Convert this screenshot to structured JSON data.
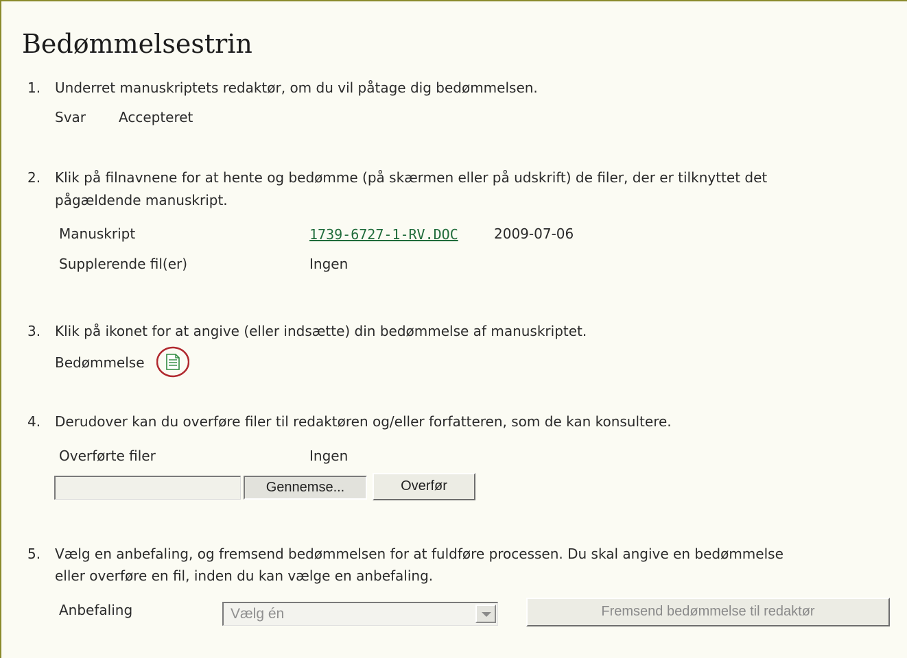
{
  "page": {
    "title": "Bedømmelsestrin"
  },
  "step1": {
    "number": "1.",
    "text": "Underret manuskriptets redaktør, om du vil påtage dig bedømmelsen.",
    "response_label": "Svar",
    "response_value": "Accepteret"
  },
  "step2": {
    "number": "2.",
    "text_line1": "Klik på filnavnene for at hente og bedømme (på skærmen eller på udskrift) de filer, der er tilknyttet det",
    "text_line2": "pågældende manuskript.",
    "manuscript_label": "Manuskript",
    "manuscript_file": "1739-6727-1-RV.DOC",
    "manuscript_date": "2009-07-06",
    "supplementary_label": "Supplerende fil(er)",
    "supplementary_value": "Ingen"
  },
  "step3": {
    "number": "3.",
    "text": "Klik på ikonet for at angive (eller indsætte) din bedømmelse af manuskriptet.",
    "review_label": "Bedømmelse",
    "review_icon": "document-icon",
    "highlight_color": "#b0282e"
  },
  "step4": {
    "number": "4.",
    "text": "Derudover kan du overføre filer til redaktøren og/eller forfatteren, som de kan konsultere.",
    "uploaded_label": "Overførte filer",
    "uploaded_value": "Ingen",
    "file_input_value": "",
    "browse_label": "Gennemse...",
    "upload_label": "Overfør"
  },
  "step5": {
    "number": "5.",
    "text_line1": "Vælg en anbefaling, og fremsend bedømmelsen for at fuldføre processen. Du skal angive en bedømmelse",
    "text_line2": "eller overføre en fil, inden du kan vælge en anbefaling.",
    "recommendation_label": "Anbefaling",
    "recommendation_selected": "Vælg én",
    "submit_label": "Fremsend bedømmelse til redaktør"
  },
  "colors": {
    "background": "#fbfbf3",
    "border": "#8a8a2c",
    "link": "#1f6b3a"
  }
}
